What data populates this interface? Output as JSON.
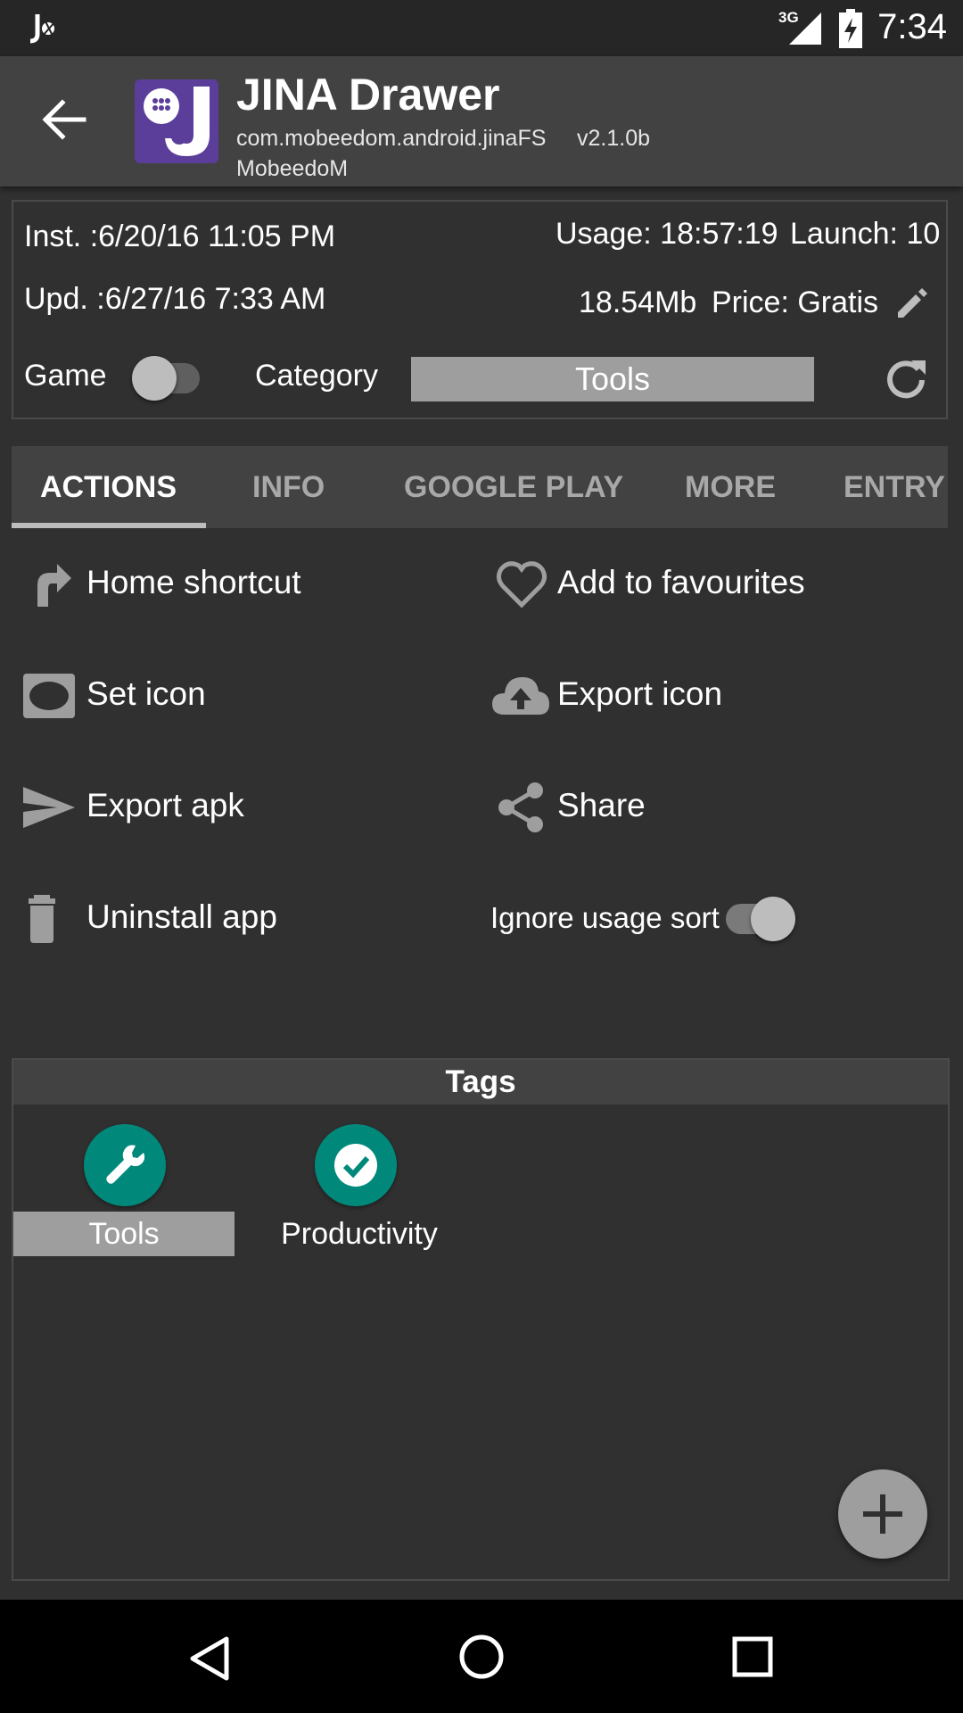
{
  "status_bar": {
    "network_type": "3G",
    "time": "7:34",
    "icons": [
      "notification-app-icon",
      "signal-icon",
      "battery-charging-icon"
    ]
  },
  "app_bar": {
    "back_icon": "arrow-left-icon",
    "app_icon": "jina-drawer-logo",
    "title": "JINA Drawer",
    "package": "com.mobeedom.android.jinaFS",
    "version": "v2.1.0b",
    "developer": "MobeedoM"
  },
  "info": {
    "installed": "Inst. :6/20/16 11:05 PM",
    "updated": "Upd. :6/27/16 7:33 AM",
    "usage": "Usage: 18:57:19",
    "launch": "Launch: 10",
    "size": "18.54Mb",
    "price": "Price: Gratis",
    "game_label": "Game",
    "game_enabled": false,
    "category_label": "Category",
    "category_value": "Tools",
    "edit_icon": "pencil-icon",
    "refresh_icon": "refresh-icon"
  },
  "tabs": [
    {
      "label": "ACTIONS",
      "active": true
    },
    {
      "label": "INFO",
      "active": false
    },
    {
      "label": "GOOGLE PLAY",
      "active": false
    },
    {
      "label": "MORE",
      "active": false
    },
    {
      "label": "ENTRY",
      "active": false
    }
  ],
  "actions": {
    "home_shortcut": "Home shortcut",
    "add_favourites": "Add to favourites",
    "set_icon": "Set icon",
    "export_icon": "Export icon",
    "export_apk": "Export apk",
    "share": "Share",
    "uninstall": "Uninstall app",
    "ignore_usage_sort": "Ignore usage sort",
    "ignore_usage_sort_enabled": true
  },
  "tags": {
    "header": "Tags",
    "items": [
      {
        "label": "Tools",
        "icon": "wrench-icon",
        "selected": true
      },
      {
        "label": "Productivity",
        "icon": "check-circle-icon",
        "selected": false
      }
    ],
    "add_icon": "plus-icon"
  },
  "nav_bar": {
    "icons": [
      "back-triangle-icon",
      "home-circle-icon",
      "recents-square-icon"
    ]
  },
  "colors": {
    "background": "#303030",
    "app_bar": "#424242",
    "tag_accent": "#00897b",
    "category_box": "#9e9e9e"
  }
}
